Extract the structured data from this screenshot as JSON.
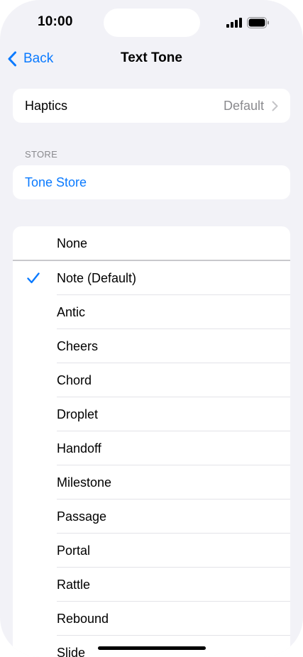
{
  "status_bar": {
    "time": "10:00",
    "signal_icon": "cellular-signal-icon",
    "battery_icon": "battery-icon"
  },
  "nav": {
    "back_label": "Back",
    "title": "Text Tone"
  },
  "haptics": {
    "label": "Haptics",
    "value": "Default"
  },
  "store_section": {
    "header": "STORE",
    "link": "Tone Store"
  },
  "tones": {
    "selected": "Note (Default)",
    "items": [
      {
        "label": "None"
      },
      {
        "label": "Note (Default)"
      },
      {
        "label": "Antic"
      },
      {
        "label": "Cheers"
      },
      {
        "label": "Chord"
      },
      {
        "label": "Droplet"
      },
      {
        "label": "Handoff"
      },
      {
        "label": "Milestone"
      },
      {
        "label": "Passage"
      },
      {
        "label": "Portal"
      },
      {
        "label": "Rattle"
      },
      {
        "label": "Rebound"
      },
      {
        "label": "Slide"
      }
    ]
  },
  "colors": {
    "accent": "#0a7aff",
    "background": "#f2f2f7",
    "secondary_text": "#8a8a8e"
  }
}
